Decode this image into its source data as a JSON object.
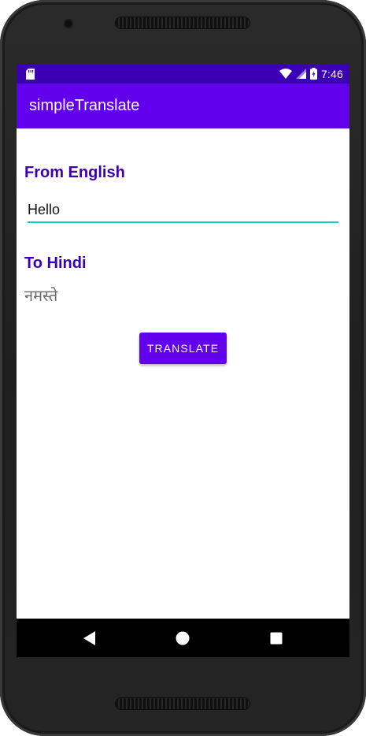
{
  "status_bar": {
    "time": "7:46",
    "icons": [
      "sd-card-icon",
      "wifi-icon",
      "signal-icon",
      "battery-charging-icon"
    ]
  },
  "app_bar": {
    "title": "simpleTranslate"
  },
  "form": {
    "from_label": "From English",
    "input_value": "Hello",
    "to_label": "To Hindi",
    "output_text": "नमस्ते",
    "translate_button": "TRANSLATE"
  },
  "nav_bar": {
    "icons": [
      "back-icon",
      "home-icon",
      "recents-icon"
    ]
  },
  "colors": {
    "primary": "#6200ee",
    "primary_dark": "#3b00b3",
    "accent": "#19c8c8"
  }
}
